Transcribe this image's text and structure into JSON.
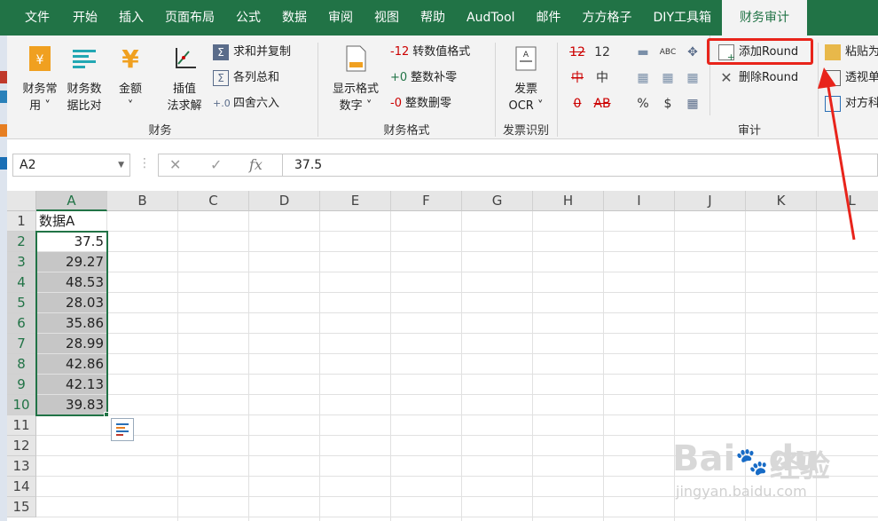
{
  "tabs": [
    "文件",
    "开始",
    "插入",
    "页面布局",
    "公式",
    "数据",
    "审阅",
    "视图",
    "帮助",
    "AudTool",
    "邮件",
    "方方格子",
    "DIY工具箱",
    "财务审计"
  ],
  "active_tab": "财务审计",
  "ribbon": {
    "finance": {
      "label": "财务",
      "btn1": [
        "财务常",
        "用"
      ],
      "btn2": [
        "财务数",
        "据比对"
      ],
      "btn3": [
        "金额"
      ],
      "btn4": [
        "插值",
        "法求解"
      ],
      "small": [
        "求和并复制",
        "各列总和",
        "四舍六入"
      ]
    },
    "format": {
      "label": "财务格式",
      "big": [
        "显示格式",
        "数字"
      ],
      "small": [
        {
          "prefix": "-12",
          "text": "转数值格式"
        },
        {
          "prefix": "+0",
          "text": "整数补零"
        },
        {
          "prefix": "-0",
          "text": "整数删零"
        }
      ]
    },
    "invoice": {
      "label": "发票识别",
      "big": [
        "发票",
        "OCR"
      ]
    },
    "audit": {
      "label": "审计",
      "glyphs": [
        "12",
        "12",
        "中",
        "中",
        "0",
        "AB",
        "%",
        "$"
      ],
      "add_round": "添加Round",
      "del_round": "删除Round",
      "right_items": [
        "粘贴为",
        "透视单",
        "对方科"
      ]
    }
  },
  "formula_bar": {
    "namebox": "A2",
    "fx": "fx",
    "value": "37.5"
  },
  "columns": [
    "A",
    "B",
    "C",
    "D",
    "E",
    "F",
    "G",
    "H",
    "I",
    "J",
    "K",
    "L"
  ],
  "rows": [
    "1",
    "2",
    "3",
    "4",
    "5",
    "6",
    "7",
    "8",
    "9",
    "10",
    "11",
    "12",
    "13",
    "14",
    "15"
  ],
  "cells": {
    "header": "数据A",
    "values": [
      "37.5",
      "29.27",
      "48.53",
      "28.03",
      "35.86",
      "28.99",
      "42.86",
      "42.13",
      "39.83"
    ]
  },
  "watermark": {
    "main": "Bai",
    "paw": "du",
    "brand": "经验",
    "url": "jingyan.baidu.com"
  },
  "colors": {
    "excel_green": "#217346",
    "callout_red": "#e8241b"
  }
}
